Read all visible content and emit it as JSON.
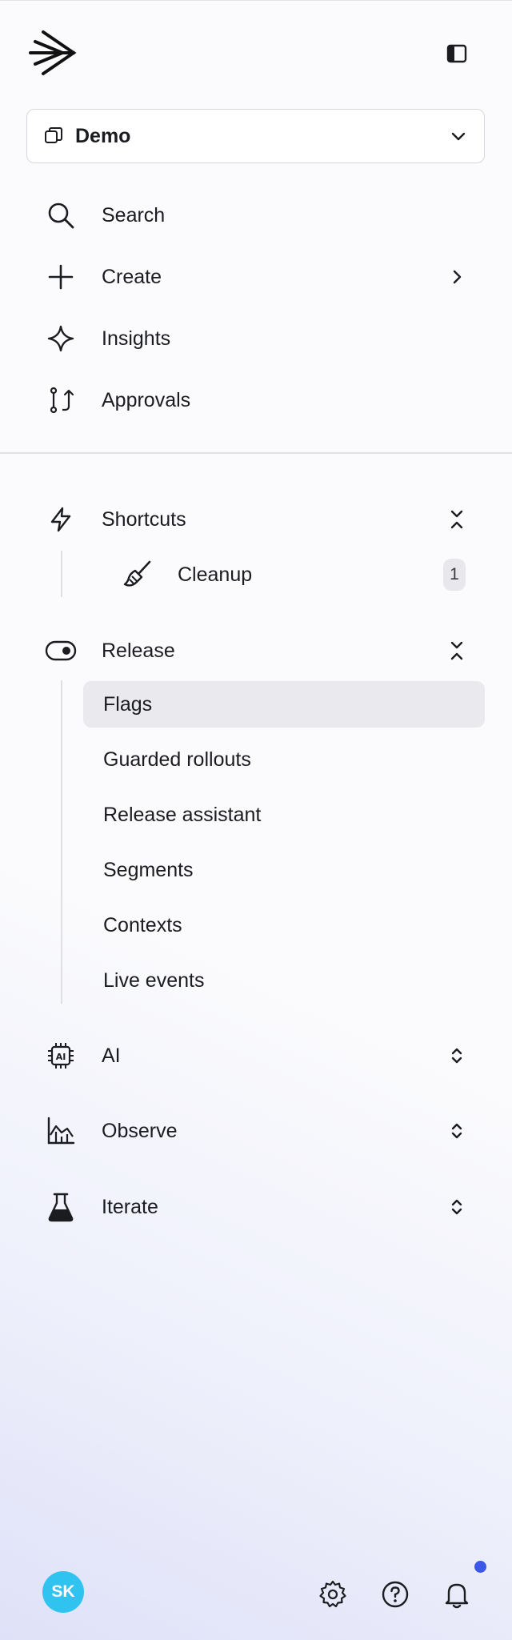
{
  "project": {
    "name": "Demo"
  },
  "nav": {
    "search": "Search",
    "create": "Create",
    "insights": "Insights",
    "approvals": "Approvals"
  },
  "shortcuts": {
    "label": "Shortcuts",
    "items": [
      {
        "label": "Cleanup",
        "count": "1"
      }
    ]
  },
  "release": {
    "label": "Release",
    "items": [
      {
        "label": "Flags",
        "active": true
      },
      {
        "label": "Guarded rollouts"
      },
      {
        "label": "Release assistant"
      },
      {
        "label": "Segments"
      },
      {
        "label": "Contexts"
      },
      {
        "label": "Live events"
      }
    ]
  },
  "sections": {
    "ai": "AI",
    "observe": "Observe",
    "iterate": "Iterate"
  },
  "user": {
    "initials": "SK"
  },
  "colors": {
    "avatar": "#30c3ef",
    "notification_dot": "#3b57e8",
    "active_bg": "#eaeaee"
  }
}
